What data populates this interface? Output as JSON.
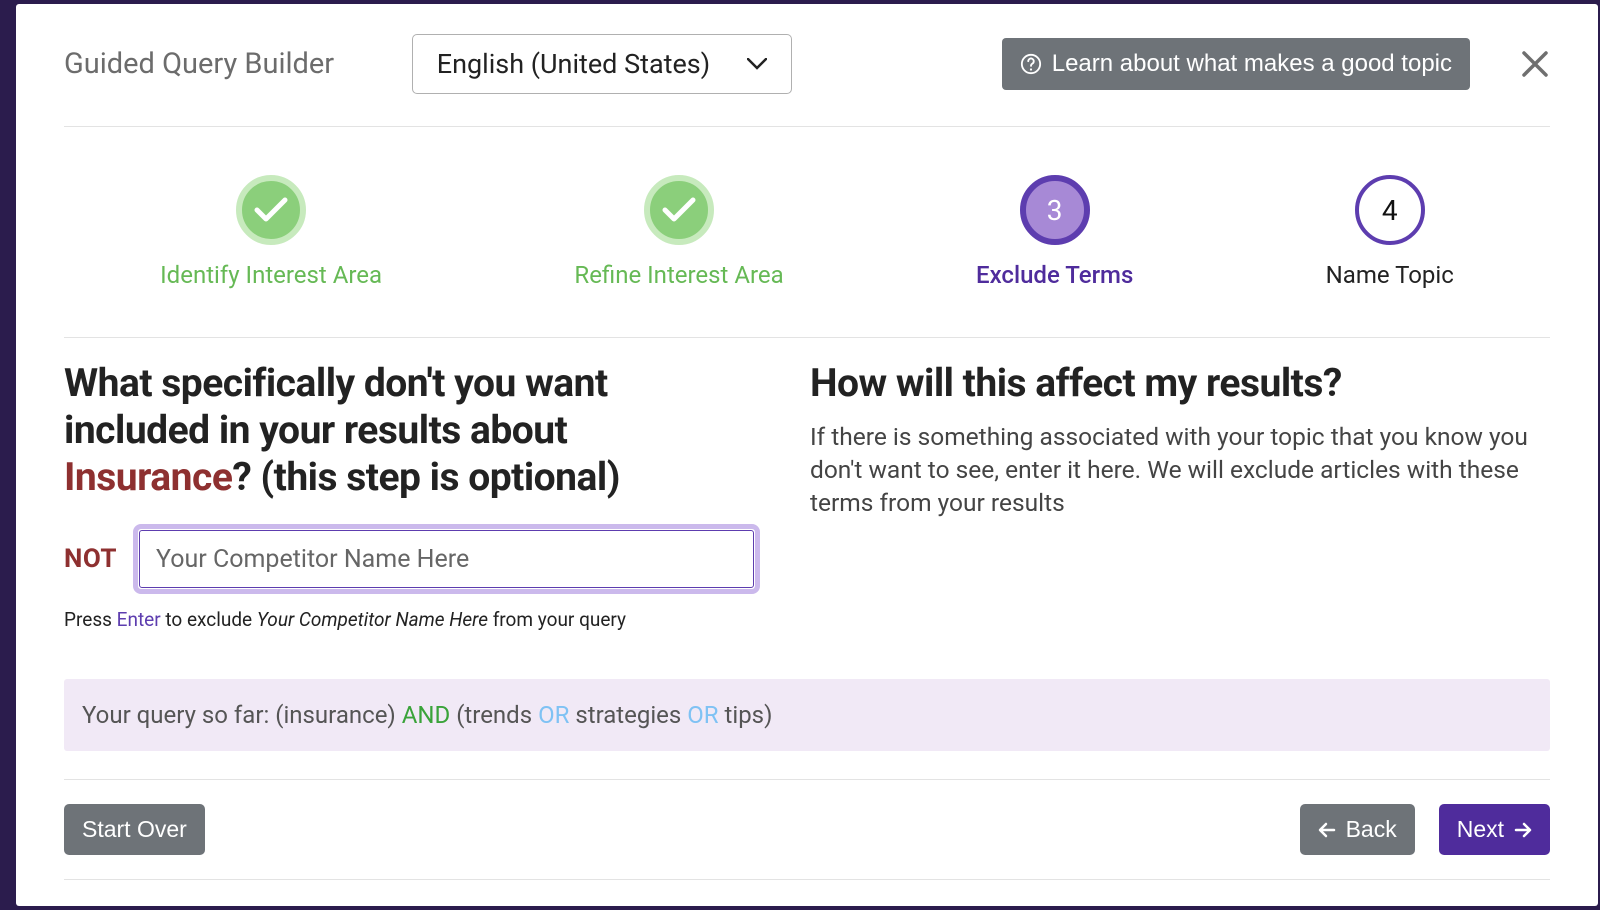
{
  "header": {
    "title": "Guided Query Builder",
    "language": "English (United States)",
    "learn_label": "Learn about what makes a good topic"
  },
  "steps": [
    {
      "label": "Identify Interest Area",
      "state": "done"
    },
    {
      "label": "Refine Interest Area",
      "state": "done"
    },
    {
      "label": "Exclude Terms",
      "state": "current",
      "num": "3"
    },
    {
      "label": "Name Topic",
      "state": "future",
      "num": "4"
    }
  ],
  "left": {
    "question_pre": "What specifically don't you want included in your results about ",
    "question_topic": "Insurance",
    "question_post": "? (this step is optional)",
    "not_label": "NOT",
    "input_placeholder": "Your Competitor Name Here",
    "hint_pre": "Press ",
    "hint_enter": "Enter",
    "hint_mid": " to exclude ",
    "hint_em": "Your Competitor Name Here",
    "hint_post": " from your query"
  },
  "right": {
    "heading": "How will this affect my results?",
    "body": "If there is something associated with your topic that you know you don't want to see, enter it here. We will exclude articles with these terms from your results"
  },
  "query": {
    "prefix": "Your query so far: ",
    "p1": "(insurance) ",
    "and": "AND",
    "p2": " (trends ",
    "or1": "OR",
    "p3": " strategies ",
    "or2": "OR",
    "p4": " tips)"
  },
  "footer": {
    "start_over": "Start Over",
    "back": "Back",
    "next": "Next"
  }
}
